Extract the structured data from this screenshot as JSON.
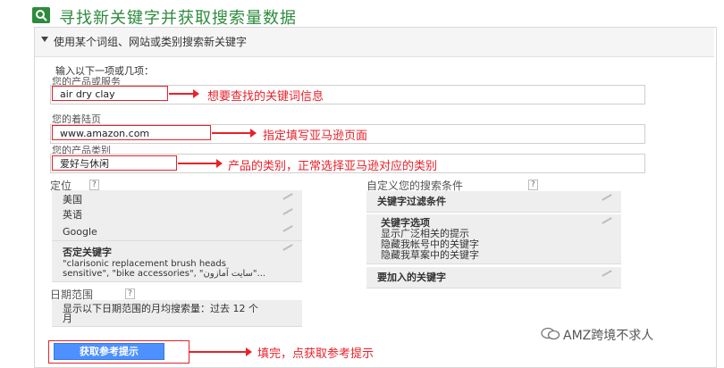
{
  "header": {
    "icon": "search-icon",
    "title": "寻找新关键字并获取搜索量数据",
    "accent": "#2e8b3e"
  },
  "section": {
    "toggle_icon": "triangle-down-icon",
    "title": "使用某个词组、网站或类别搜索新关键字"
  },
  "form": {
    "intro": "输入以下一项或几项：",
    "product": {
      "label": "您的产品或服务",
      "value": "air dry clay"
    },
    "landing": {
      "label": "您的着陆页",
      "value": "www.amazon.com"
    },
    "category": {
      "label": "您的产品类别",
      "value": "爱好与休闲"
    }
  },
  "annotations": {
    "product": "想要查找的关键词信息",
    "landing": "指定填写亚马逊页面",
    "category": "产品的类别，正常选择亚马逊对应的类别",
    "submit": "填完，点获取参考提示",
    "color": "#e8212b"
  },
  "targeting": {
    "label": "定位",
    "help": "?",
    "items": [
      "美国",
      "英语",
      "Google"
    ],
    "negative": {
      "title": "否定关键字",
      "text": "\"clarisonic replacement brush heads sensitive\", \"bike accessories\", \"سايت آمازون\"..."
    }
  },
  "date_range": {
    "label": "日期范围",
    "help": "?",
    "text": "显示以下日期范围的月均搜索量：过去 12 个月"
  },
  "custom": {
    "label": "自定义您的搜索条件",
    "help": "?",
    "filter_title": "关键字过滤条件",
    "options_title": "关键字选项",
    "options": [
      "显示广泛相关的提示",
      "隐藏我帐号中的关键字",
      "隐藏我草案中的关键字"
    ],
    "include_title": "要加入的关键字"
  },
  "submit_label": "获取参考提示",
  "watermark": {
    "icon": "wechat-icon",
    "text": "AMZ跨境不求人"
  }
}
